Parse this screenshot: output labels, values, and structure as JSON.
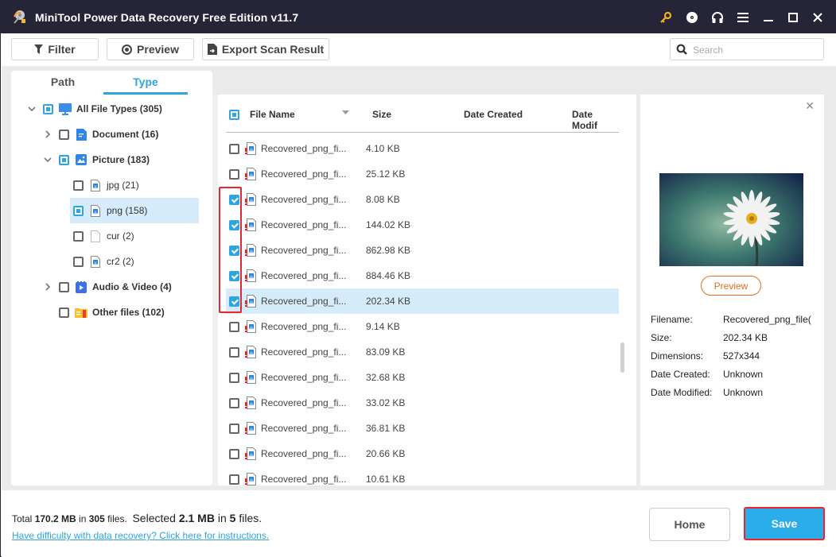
{
  "window": {
    "title": "MiniTool Power Data Recovery Free Edition v11.7",
    "title_icons": [
      "key-icon",
      "disc-icon",
      "headphones-icon",
      "menu-icon",
      "minimize-icon",
      "maximize-icon",
      "close-icon"
    ]
  },
  "toolbar": {
    "filter_label": "Filter",
    "preview_label": "Preview",
    "export_label": "Export Scan Result",
    "search_placeholder": "Search"
  },
  "left_panel": {
    "tabs": [
      {
        "label": "Path",
        "active": false
      },
      {
        "label": "Type",
        "active": true
      }
    ],
    "tree": [
      {
        "label": "All File Types (305)",
        "level": 0,
        "expander": "expanded",
        "check": "partial",
        "icon": "monitor-icon",
        "bold": true
      },
      {
        "label": "Document (16)",
        "level": 1,
        "expander": "collapsed",
        "check": "unchecked",
        "icon": "document-icon",
        "bold": true
      },
      {
        "label": "Picture (183)",
        "level": 1,
        "expander": "expanded",
        "check": "partial",
        "icon": "picture-icon",
        "bold": true
      },
      {
        "label": "jpg (21)",
        "level": 2,
        "expander": "none",
        "check": "unchecked",
        "icon": "image-file-icon",
        "bold": false
      },
      {
        "label": "png (158)",
        "level": 2,
        "expander": "none",
        "check": "partial",
        "icon": "image-file-icon",
        "bold": false,
        "selected": true
      },
      {
        "label": "cur (2)",
        "level": 2,
        "expander": "none",
        "check": "unchecked",
        "icon": "blank-file-icon",
        "bold": false
      },
      {
        "label": "cr2 (2)",
        "level": 2,
        "expander": "none",
        "check": "unchecked",
        "icon": "image-file-icon",
        "bold": false
      },
      {
        "label": "Audio & Video (4)",
        "level": 1,
        "expander": "collapsed",
        "check": "unchecked",
        "icon": "video-icon",
        "bold": true
      },
      {
        "label": "Other files (102)",
        "level": 1,
        "expander": "none",
        "check": "unchecked",
        "icon": "folder-icon",
        "bold": true
      }
    ]
  },
  "file_list": {
    "columns": [
      "File Name",
      "Size",
      "Date Created",
      "Date Modif"
    ],
    "header_check": "partial",
    "rows": [
      {
        "name": "Recovered_png_fi...",
        "size": "4.10 KB",
        "checked": false
      },
      {
        "name": "Recovered_png_fi...",
        "size": "25.12 KB",
        "checked": false
      },
      {
        "name": "Recovered_png_fi...",
        "size": "8.08 KB",
        "checked": true
      },
      {
        "name": "Recovered_png_fi...",
        "size": "144.02 KB",
        "checked": true
      },
      {
        "name": "Recovered_png_fi...",
        "size": "862.98 KB",
        "checked": true
      },
      {
        "name": "Recovered_png_fi...",
        "size": "884.46 KB",
        "checked": true
      },
      {
        "name": "Recovered_png_fi...",
        "size": "202.34 KB",
        "checked": true,
        "selected": true
      },
      {
        "name": "Recovered_png_fi...",
        "size": "9.14 KB",
        "checked": false
      },
      {
        "name": "Recovered_png_fi...",
        "size": "83.09 KB",
        "checked": false
      },
      {
        "name": "Recovered_png_fi...",
        "size": "32.68 KB",
        "checked": false
      },
      {
        "name": "Recovered_png_fi...",
        "size": "33.02 KB",
        "checked": false
      },
      {
        "name": "Recovered_png_fi...",
        "size": "36.81 KB",
        "checked": false
      },
      {
        "name": "Recovered_png_fi...",
        "size": "20.66 KB",
        "checked": false
      },
      {
        "name": "Recovered_png_fi...",
        "size": "10.61 KB",
        "checked": false
      }
    ]
  },
  "preview": {
    "button_label": "Preview",
    "meta": [
      {
        "key": "Filename:",
        "value": "Recovered_png_file("
      },
      {
        "key": "Size:",
        "value": "202.34 KB"
      },
      {
        "key": "Dimensions:",
        "value": "527x344"
      },
      {
        "key": "Date Created:",
        "value": "Unknown"
      },
      {
        "key": "Date Modified:",
        "value": "Unknown"
      }
    ]
  },
  "footer": {
    "total_prefix": "Total ",
    "total_size": "170.2 MB",
    "total_mid": " in ",
    "total_count": "305",
    "total_suffix": " files.",
    "selected_prefix": "Selected ",
    "selected_size": "2.1 MB",
    "selected_mid": " in ",
    "selected_count": "5",
    "selected_suffix": " files.",
    "help_link": "Have difficulty with data recovery? Click here for instructions.",
    "home_label": "Home",
    "save_label": "Save"
  },
  "colors": {
    "accent": "#2fa4df",
    "titlebar": "#262538",
    "highlight": "#e8262b",
    "save": "#2badea",
    "preview_button": "#e07020",
    "key_icon": "#f2b01e"
  }
}
